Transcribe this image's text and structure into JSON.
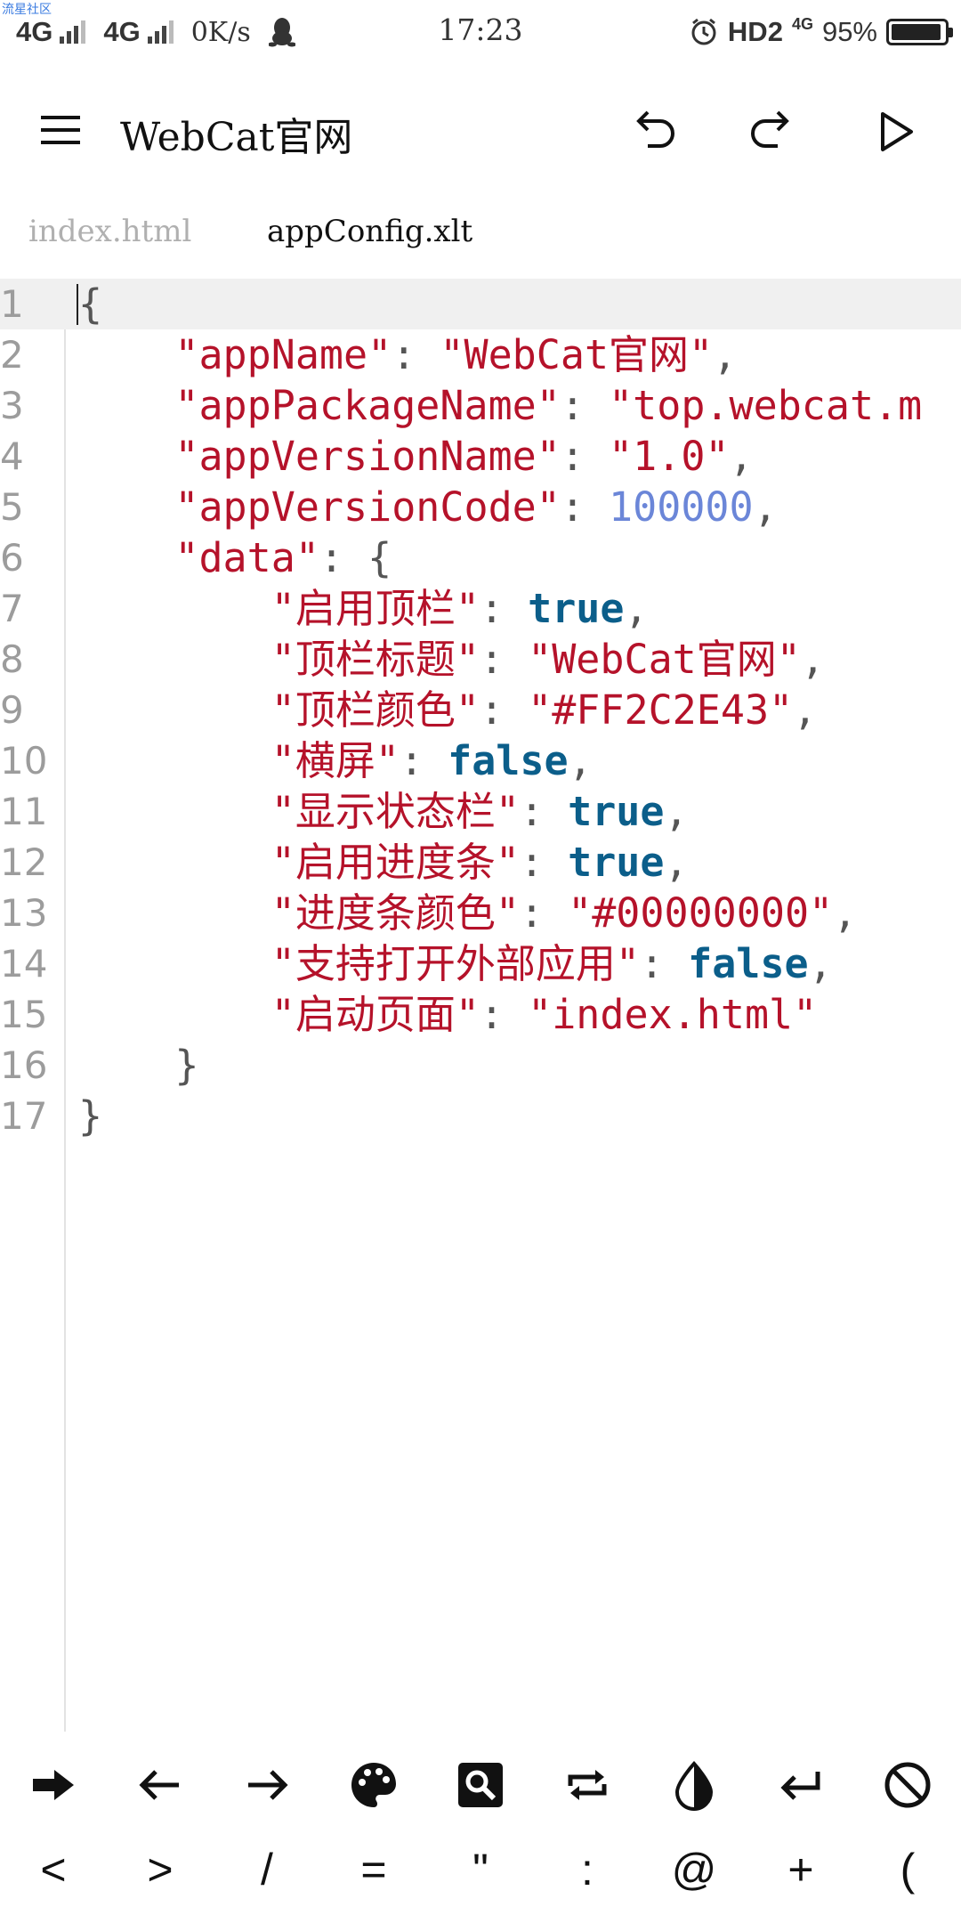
{
  "status_bar": {
    "watermark": "流星社区",
    "signal1": "4G",
    "signal2": "4G",
    "speed": "0K/s",
    "time": "17:23",
    "hd": "HD2",
    "net_small": "4G",
    "battery": "95%",
    "battery_level": 0.95
  },
  "toolbar": {
    "title": "WebCat官网",
    "icons": [
      "menu-icon",
      "undo-icon",
      "redo-icon",
      "play-icon"
    ]
  },
  "tabs": [
    {
      "label": "index.html",
      "active": false
    },
    {
      "label": "appConfig.xlt",
      "active": true
    }
  ],
  "editor": {
    "line_numbers": [
      "1",
      "2",
      "3",
      "4",
      "5",
      "6",
      "7",
      "8",
      "9",
      "10",
      "11",
      "12",
      "13",
      "14",
      "15",
      "16",
      "17"
    ],
    "colors": {
      "key": "#b5122a",
      "bool": "#0b5e8a",
      "number": "#6b86d8",
      "punct": "#555555"
    },
    "lines": [
      {
        "indent": "",
        "tokens": [
          {
            "t": "p",
            "v": "{"
          }
        ]
      },
      {
        "indent": "    ",
        "tokens": [
          {
            "t": "k",
            "v": "\"appName\""
          },
          {
            "t": "p",
            "v": ": "
          },
          {
            "t": "s",
            "v": "\"WebCat官网\""
          },
          {
            "t": "p",
            "v": ","
          }
        ]
      },
      {
        "indent": "    ",
        "tokens": [
          {
            "t": "k",
            "v": "\"appPackageName\""
          },
          {
            "t": "p",
            "v": ": "
          },
          {
            "t": "s",
            "v": "\"top.webcat.m"
          }
        ]
      },
      {
        "indent": "    ",
        "tokens": [
          {
            "t": "k",
            "v": "\"appVersionName\""
          },
          {
            "t": "p",
            "v": ": "
          },
          {
            "t": "s",
            "v": "\"1.0\""
          },
          {
            "t": "p",
            "v": ","
          }
        ]
      },
      {
        "indent": "    ",
        "tokens": [
          {
            "t": "k",
            "v": "\"appVersionCode\""
          },
          {
            "t": "p",
            "v": ": "
          },
          {
            "t": "n",
            "v": "100000"
          },
          {
            "t": "p",
            "v": ","
          }
        ]
      },
      {
        "indent": "    ",
        "tokens": [
          {
            "t": "k",
            "v": "\"data\""
          },
          {
            "t": "p",
            "v": ": {"
          }
        ]
      },
      {
        "indent": "        ",
        "tokens": [
          {
            "t": "k",
            "v": "\"启用顶栏\""
          },
          {
            "t": "p",
            "v": ": "
          },
          {
            "t": "b",
            "v": "true"
          },
          {
            "t": "p",
            "v": ","
          }
        ]
      },
      {
        "indent": "        ",
        "tokens": [
          {
            "t": "k",
            "v": "\"顶栏标题\""
          },
          {
            "t": "p",
            "v": ": "
          },
          {
            "t": "s",
            "v": "\"WebCat官网\""
          },
          {
            "t": "p",
            "v": ","
          }
        ]
      },
      {
        "indent": "        ",
        "tokens": [
          {
            "t": "k",
            "v": "\"顶栏颜色\""
          },
          {
            "t": "p",
            "v": ": "
          },
          {
            "t": "s",
            "v": "\"#FF2C2E43\""
          },
          {
            "t": "p",
            "v": ","
          }
        ]
      },
      {
        "indent": "        ",
        "tokens": [
          {
            "t": "k",
            "v": "\"横屏\""
          },
          {
            "t": "p",
            "v": ": "
          },
          {
            "t": "b",
            "v": "false"
          },
          {
            "t": "p",
            "v": ","
          }
        ]
      },
      {
        "indent": "        ",
        "tokens": [
          {
            "t": "k",
            "v": "\"显示状态栏\""
          },
          {
            "t": "p",
            "v": ": "
          },
          {
            "t": "b",
            "v": "true"
          },
          {
            "t": "p",
            "v": ","
          }
        ]
      },
      {
        "indent": "        ",
        "tokens": [
          {
            "t": "k",
            "v": "\"启用进度条\""
          },
          {
            "t": "p",
            "v": ": "
          },
          {
            "t": "b",
            "v": "true"
          },
          {
            "t": "p",
            "v": ","
          }
        ]
      },
      {
        "indent": "        ",
        "tokens": [
          {
            "t": "k",
            "v": "\"进度条颜色\""
          },
          {
            "t": "p",
            "v": ": "
          },
          {
            "t": "s",
            "v": "\"#00000000\""
          },
          {
            "t": "p",
            "v": ","
          }
        ]
      },
      {
        "indent": "        ",
        "tokens": [
          {
            "t": "k",
            "v": "\"支持打开外部应用\""
          },
          {
            "t": "p",
            "v": ": "
          },
          {
            "t": "b",
            "v": "false"
          },
          {
            "t": "p",
            "v": ","
          }
        ]
      },
      {
        "indent": "        ",
        "tokens": [
          {
            "t": "k",
            "v": "\"启动页面\""
          },
          {
            "t": "p",
            "v": ": "
          },
          {
            "t": "s",
            "v": "\"index.html\""
          }
        ]
      },
      {
        "indent": "    ",
        "tokens": [
          {
            "t": "p",
            "v": "}"
          }
        ]
      },
      {
        "indent": "",
        "tokens": [
          {
            "t": "p",
            "v": "}"
          }
        ]
      }
    ]
  },
  "key_bar": {
    "row1_icons": [
      "tab-arrow-icon",
      "left-arrow-icon",
      "right-arrow-icon",
      "palette-icon",
      "search-icon",
      "repeat-icon",
      "contrast-icon",
      "enter-icon",
      "block-icon"
    ],
    "row2": [
      "<",
      ">",
      "/",
      "=",
      "\"",
      ":",
      "@",
      "+",
      "("
    ]
  }
}
